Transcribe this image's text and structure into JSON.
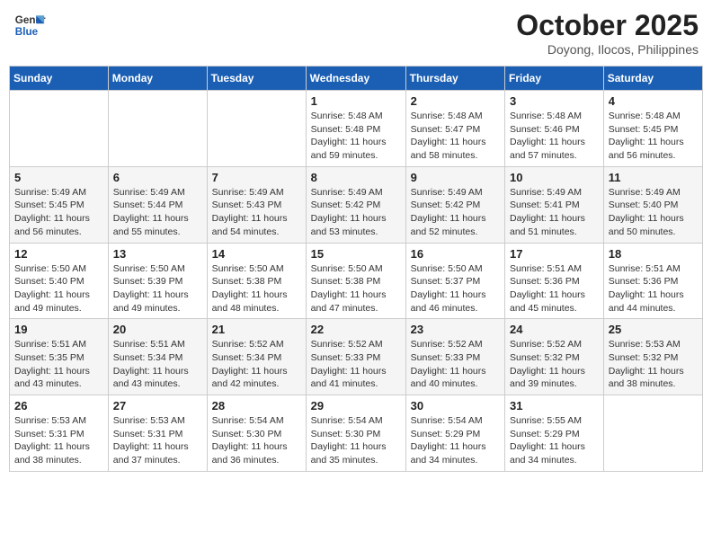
{
  "header": {
    "logo_line1": "General",
    "logo_line2": "Blue",
    "month": "October 2025",
    "location": "Doyong, Ilocos, Philippines"
  },
  "weekdays": [
    "Sunday",
    "Monday",
    "Tuesday",
    "Wednesday",
    "Thursday",
    "Friday",
    "Saturday"
  ],
  "weeks": [
    [
      {
        "day": "",
        "sunrise": "",
        "sunset": "",
        "daylight": ""
      },
      {
        "day": "",
        "sunrise": "",
        "sunset": "",
        "daylight": ""
      },
      {
        "day": "",
        "sunrise": "",
        "sunset": "",
        "daylight": ""
      },
      {
        "day": "1",
        "sunrise": "Sunrise: 5:48 AM",
        "sunset": "Sunset: 5:48 PM",
        "daylight": "Daylight: 11 hours and 59 minutes."
      },
      {
        "day": "2",
        "sunrise": "Sunrise: 5:48 AM",
        "sunset": "Sunset: 5:47 PM",
        "daylight": "Daylight: 11 hours and 58 minutes."
      },
      {
        "day": "3",
        "sunrise": "Sunrise: 5:48 AM",
        "sunset": "Sunset: 5:46 PM",
        "daylight": "Daylight: 11 hours and 57 minutes."
      },
      {
        "day": "4",
        "sunrise": "Sunrise: 5:48 AM",
        "sunset": "Sunset: 5:45 PM",
        "daylight": "Daylight: 11 hours and 56 minutes."
      }
    ],
    [
      {
        "day": "5",
        "sunrise": "Sunrise: 5:49 AM",
        "sunset": "Sunset: 5:45 PM",
        "daylight": "Daylight: 11 hours and 56 minutes."
      },
      {
        "day": "6",
        "sunrise": "Sunrise: 5:49 AM",
        "sunset": "Sunset: 5:44 PM",
        "daylight": "Daylight: 11 hours and 55 minutes."
      },
      {
        "day": "7",
        "sunrise": "Sunrise: 5:49 AM",
        "sunset": "Sunset: 5:43 PM",
        "daylight": "Daylight: 11 hours and 54 minutes."
      },
      {
        "day": "8",
        "sunrise": "Sunrise: 5:49 AM",
        "sunset": "Sunset: 5:42 PM",
        "daylight": "Daylight: 11 hours and 53 minutes."
      },
      {
        "day": "9",
        "sunrise": "Sunrise: 5:49 AM",
        "sunset": "Sunset: 5:42 PM",
        "daylight": "Daylight: 11 hours and 52 minutes."
      },
      {
        "day": "10",
        "sunrise": "Sunrise: 5:49 AM",
        "sunset": "Sunset: 5:41 PM",
        "daylight": "Daylight: 11 hours and 51 minutes."
      },
      {
        "day": "11",
        "sunrise": "Sunrise: 5:49 AM",
        "sunset": "Sunset: 5:40 PM",
        "daylight": "Daylight: 11 hours and 50 minutes."
      }
    ],
    [
      {
        "day": "12",
        "sunrise": "Sunrise: 5:50 AM",
        "sunset": "Sunset: 5:40 PM",
        "daylight": "Daylight: 11 hours and 49 minutes."
      },
      {
        "day": "13",
        "sunrise": "Sunrise: 5:50 AM",
        "sunset": "Sunset: 5:39 PM",
        "daylight": "Daylight: 11 hours and 49 minutes."
      },
      {
        "day": "14",
        "sunrise": "Sunrise: 5:50 AM",
        "sunset": "Sunset: 5:38 PM",
        "daylight": "Daylight: 11 hours and 48 minutes."
      },
      {
        "day": "15",
        "sunrise": "Sunrise: 5:50 AM",
        "sunset": "Sunset: 5:38 PM",
        "daylight": "Daylight: 11 hours and 47 minutes."
      },
      {
        "day": "16",
        "sunrise": "Sunrise: 5:50 AM",
        "sunset": "Sunset: 5:37 PM",
        "daylight": "Daylight: 11 hours and 46 minutes."
      },
      {
        "day": "17",
        "sunrise": "Sunrise: 5:51 AM",
        "sunset": "Sunset: 5:36 PM",
        "daylight": "Daylight: 11 hours and 45 minutes."
      },
      {
        "day": "18",
        "sunrise": "Sunrise: 5:51 AM",
        "sunset": "Sunset: 5:36 PM",
        "daylight": "Daylight: 11 hours and 44 minutes."
      }
    ],
    [
      {
        "day": "19",
        "sunrise": "Sunrise: 5:51 AM",
        "sunset": "Sunset: 5:35 PM",
        "daylight": "Daylight: 11 hours and 43 minutes."
      },
      {
        "day": "20",
        "sunrise": "Sunrise: 5:51 AM",
        "sunset": "Sunset: 5:34 PM",
        "daylight": "Daylight: 11 hours and 43 minutes."
      },
      {
        "day": "21",
        "sunrise": "Sunrise: 5:52 AM",
        "sunset": "Sunset: 5:34 PM",
        "daylight": "Daylight: 11 hours and 42 minutes."
      },
      {
        "day": "22",
        "sunrise": "Sunrise: 5:52 AM",
        "sunset": "Sunset: 5:33 PM",
        "daylight": "Daylight: 11 hours and 41 minutes."
      },
      {
        "day": "23",
        "sunrise": "Sunrise: 5:52 AM",
        "sunset": "Sunset: 5:33 PM",
        "daylight": "Daylight: 11 hours and 40 minutes."
      },
      {
        "day": "24",
        "sunrise": "Sunrise: 5:52 AM",
        "sunset": "Sunset: 5:32 PM",
        "daylight": "Daylight: 11 hours and 39 minutes."
      },
      {
        "day": "25",
        "sunrise": "Sunrise: 5:53 AM",
        "sunset": "Sunset: 5:32 PM",
        "daylight": "Daylight: 11 hours and 38 minutes."
      }
    ],
    [
      {
        "day": "26",
        "sunrise": "Sunrise: 5:53 AM",
        "sunset": "Sunset: 5:31 PM",
        "daylight": "Daylight: 11 hours and 38 minutes."
      },
      {
        "day": "27",
        "sunrise": "Sunrise: 5:53 AM",
        "sunset": "Sunset: 5:31 PM",
        "daylight": "Daylight: 11 hours and 37 minutes."
      },
      {
        "day": "28",
        "sunrise": "Sunrise: 5:54 AM",
        "sunset": "Sunset: 5:30 PM",
        "daylight": "Daylight: 11 hours and 36 minutes."
      },
      {
        "day": "29",
        "sunrise": "Sunrise: 5:54 AM",
        "sunset": "Sunset: 5:30 PM",
        "daylight": "Daylight: 11 hours and 35 minutes."
      },
      {
        "day": "30",
        "sunrise": "Sunrise: 5:54 AM",
        "sunset": "Sunset: 5:29 PM",
        "daylight": "Daylight: 11 hours and 34 minutes."
      },
      {
        "day": "31",
        "sunrise": "Sunrise: 5:55 AM",
        "sunset": "Sunset: 5:29 PM",
        "daylight": "Daylight: 11 hours and 34 minutes."
      },
      {
        "day": "",
        "sunrise": "",
        "sunset": "",
        "daylight": ""
      }
    ]
  ]
}
